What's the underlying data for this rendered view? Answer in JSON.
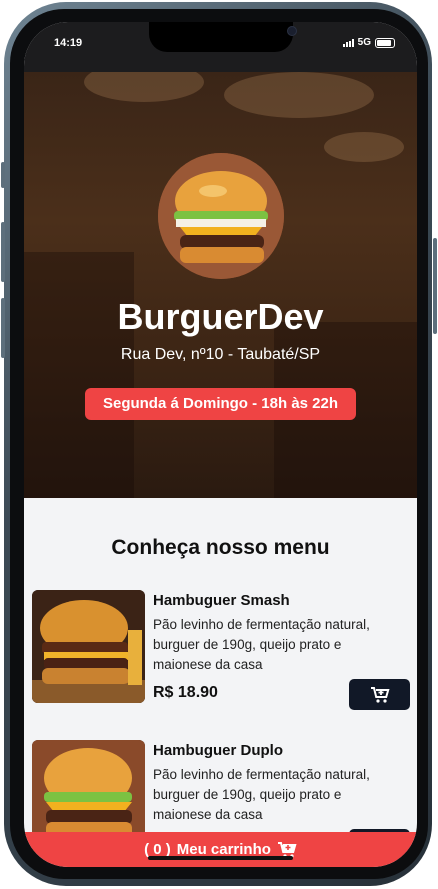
{
  "status_bar": {
    "time": "14:19",
    "network": "5G"
  },
  "hero": {
    "logo_icon": "burger-logo",
    "name": "BurguerDev",
    "address": "Rua Dev, nº10 - Taubaté/SP",
    "hours": "Segunda á Domingo - 18h às 22h"
  },
  "menu": {
    "title": "Conheça nosso menu",
    "items": [
      {
        "name": "Hambuguer Smash",
        "description": "Pão levinho de fermentação natural, burguer de 190g, queijo prato e maionese da casa",
        "price": "R$ 18.90",
        "button_icon": "add-to-cart-icon"
      },
      {
        "name": "Hambuguer Duplo",
        "description": "Pão levinho de fermentação natural, burguer de 190g, queijo prato e maionese da casa",
        "button_icon": "add-to-cart-icon"
      }
    ]
  },
  "cart": {
    "count": "( 0 )",
    "label": "Meu carrinho",
    "icon": "cart-icon"
  },
  "colors": {
    "accent": "#ef4444",
    "button": "#111827",
    "background": "#f3f4f6"
  }
}
